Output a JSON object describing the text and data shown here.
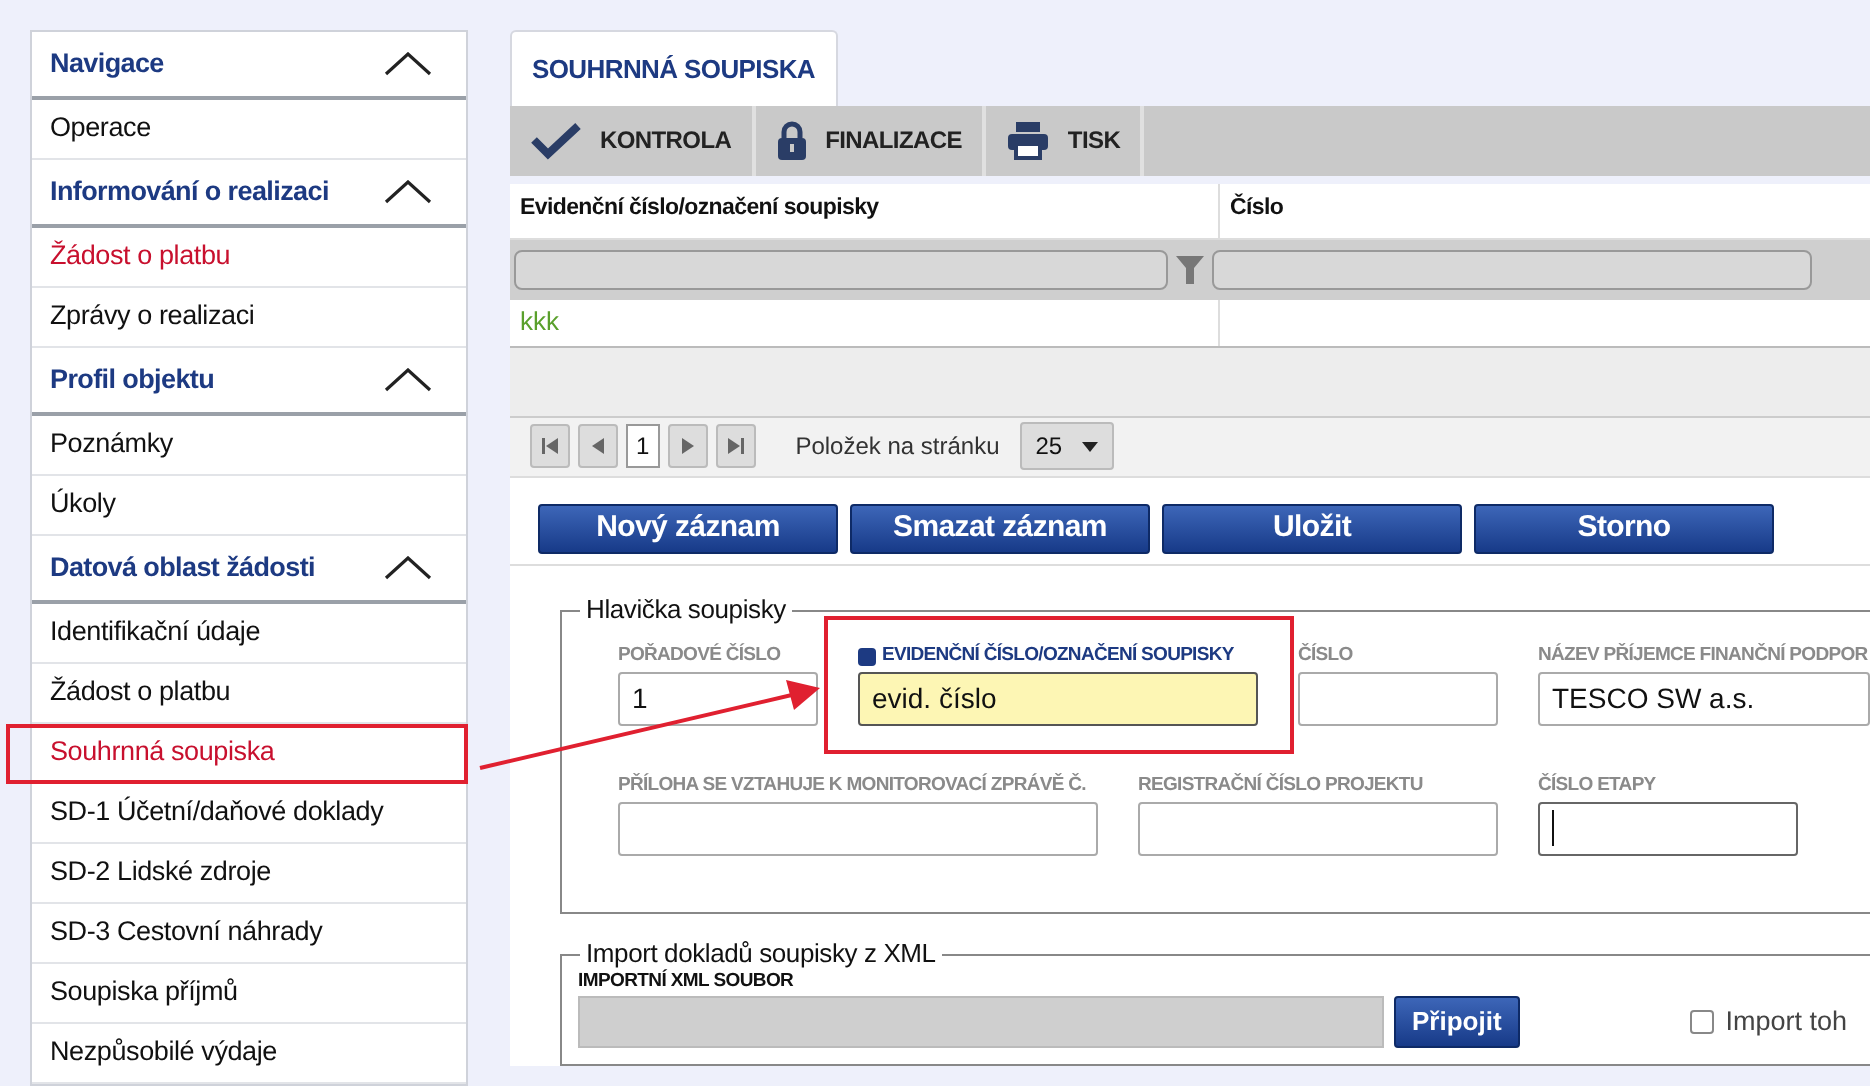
{
  "sidebar": {
    "sections": [
      {
        "title": "Navigace",
        "expanded": true,
        "items": [
          {
            "label": "Operace",
            "selected": false,
            "highlighted": false
          }
        ]
      },
      {
        "title": "Informování o realizaci",
        "expanded": true,
        "items": [
          {
            "label": "Žádost o platbu",
            "selected": true,
            "highlighted": false
          },
          {
            "label": "Zprávy o realizaci",
            "selected": false,
            "highlighted": false
          }
        ]
      },
      {
        "title": "Profil objektu",
        "expanded": true,
        "items": [
          {
            "label": "Poznámky",
            "selected": false,
            "highlighted": false
          },
          {
            "label": "Úkoly",
            "selected": false,
            "highlighted": false
          }
        ]
      },
      {
        "title": "Datová oblast žádosti",
        "expanded": true,
        "items": [
          {
            "label": "Identifikační údaje",
            "selected": false,
            "highlighted": false
          },
          {
            "label": "Žádost o platbu",
            "selected": false,
            "highlighted": false
          },
          {
            "label": "Souhrnná soupiska",
            "selected": true,
            "highlighted": true
          },
          {
            "label": "SD-1 Účetní/daňové doklady",
            "selected": false,
            "highlighted": false
          },
          {
            "label": "SD-2 Lidské zdroje",
            "selected": false,
            "highlighted": false
          },
          {
            "label": "SD-3 Cestovní náhrady",
            "selected": false,
            "highlighted": false
          },
          {
            "label": "Soupiska příjmů",
            "selected": false,
            "highlighted": false
          },
          {
            "label": "Nezpůsobilé výdaje",
            "selected": false,
            "highlighted": false
          }
        ]
      }
    ]
  },
  "tabs": [
    {
      "label": "SOUHRNNÁ SOUPISKA",
      "selected": true
    }
  ],
  "toolbar": [
    {
      "label": "KONTROLA",
      "kind": "check"
    },
    {
      "label": "FINALIZACE",
      "kind": "lock"
    },
    {
      "label": "TISK",
      "kind": "print"
    }
  ],
  "table": {
    "columns": [
      "Evidenční číslo/označení soupisky",
      "Číslo"
    ],
    "rows": [
      {
        "cells": [
          "kkk"
        ]
      }
    ]
  },
  "pager": {
    "page": "1",
    "page_size_label": "Položek na stránku",
    "page_size": "25"
  },
  "actions": [
    "Nový záznam",
    "Smazat záznam",
    "Uložit",
    "Storno"
  ],
  "header_fieldset": {
    "title": "Hlavička soupisky",
    "fields": [
      {
        "label": "POŘADOVÉ ČÍSLO",
        "value": "1",
        "required": false,
        "highlighted": false,
        "focused": false
      },
      {
        "label": "EVIDENČNÍ ČÍSLO/OZNAČENÍ SOUPISKY",
        "value": "evid. číslo",
        "required": true,
        "highlighted": true,
        "focused": false
      },
      {
        "label": "ČÍSLO",
        "required": false,
        "highlighted": false,
        "focused": false
      },
      {
        "label": "NÁZEV PŘÍJEMCE FINANČNÍ PODPOR",
        "value": "TESCO SW a.s.",
        "required": false,
        "highlighted": false,
        "focused": false
      },
      {
        "label": "PŘÍLOHA SE VZTAHUJE K MONITOROVACÍ ZPRÁVĚ Č.",
        "required": false,
        "highlighted": false,
        "focused": false
      },
      {
        "label": "REGISTRAČNÍ ČÍSLO PROJEKTU",
        "required": false,
        "highlighted": false,
        "focused": false
      },
      {
        "label": "ČÍSLO ETAPY",
        "required": false,
        "highlighted": false,
        "focused": true
      }
    ]
  },
  "import_fieldset": {
    "title": "Import dokladů soupisky z XML",
    "file_label": "IMPORTNÍ XML SOUBOR",
    "button": "Připojit",
    "checkbox": {
      "label": "Import toh",
      "checked": false
    }
  }
}
